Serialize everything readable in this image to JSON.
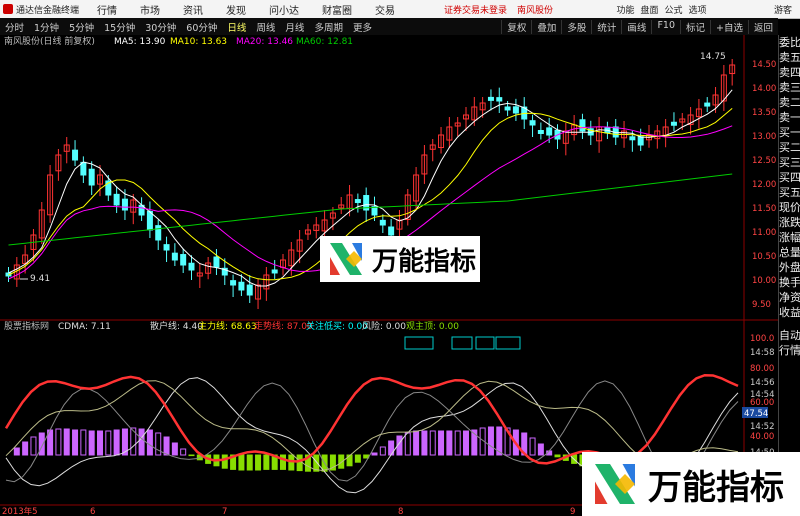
{
  "app": {
    "title": "通达信金融终端",
    "menu": [
      "行情",
      "市场",
      "资讯",
      "发现",
      "问小达",
      "财富圈",
      "交易"
    ],
    "warning": "证券交易未登录",
    "stock_name": "南风股份",
    "right_items": [
      "功能",
      "盘面",
      "公式",
      "选项"
    ],
    "user": "游客"
  },
  "periods": [
    "分时",
    "1分钟",
    "5分钟",
    "15分钟",
    "30分钟",
    "60分钟",
    "日线",
    "周线",
    "月线",
    "多周期",
    "更多"
  ],
  "active_period": "日线",
  "tools": [
    "复权",
    "叠加",
    "多股",
    "统计",
    "画线",
    "F10",
    "标记",
    "+自选",
    "返回"
  ],
  "sidebar": [
    "委比",
    "卖五",
    "卖四",
    "卖三",
    "卖二",
    "卖一",
    "买一",
    "买二",
    "买三",
    "买四",
    "买五",
    "现价",
    "涨跌",
    "涨幅",
    "总量",
    "外盘",
    "换手",
    "净资",
    "收益"
  ],
  "sidebar_bottom": [
    "自动",
    "行情"
  ],
  "main_header": {
    "name": "南风股份(日线 前复权)",
    "ma5": "MA5: 13.90",
    "ma10": "MA10: 13.63",
    "ma20": "MA20: 13.46",
    "ma60": "MA60: 12.81",
    "high_label": "14.75",
    "low_label": "9.41"
  },
  "price_axis": [
    "14.50",
    "14.00",
    "13.50",
    "13.00",
    "12.50",
    "12.00",
    "11.50",
    "11.00",
    "10.50",
    "10.00",
    "9.50"
  ],
  "ind_header": {
    "name": "股票指标网",
    "cdma": "CDMA: 7.11",
    "sanhu": "散户线: 4.40",
    "zhuli": "主力线: 68.63",
    "zoushi": "走势线: 87.00",
    "guanzhu": "关注低买: 0.00",
    "fengxian": "风险: 0.00",
    "guanzhuding": "观主顶: 0.00"
  },
  "ind_axis": [
    "100.0",
    "80.00",
    "60.00",
    "40.00"
  ],
  "ind_time_labels": [
    "14:58",
    "14:56",
    "14:54",
    "14:52",
    "14:50"
  ],
  "ind_current": "47.54",
  "date_axis": [
    "2013年5",
    "6",
    "7",
    "8",
    "9"
  ],
  "watermark": "万能指标",
  "colors": {
    "up": "#ff3333",
    "down": "#54ffff",
    "ma5": "#ffffff",
    "ma10": "#ffff00",
    "ma20": "#ff00ff",
    "ma60": "#00cc00",
    "bull_bar": "#cc66ff",
    "bear_bar": "#88dd00"
  }
}
